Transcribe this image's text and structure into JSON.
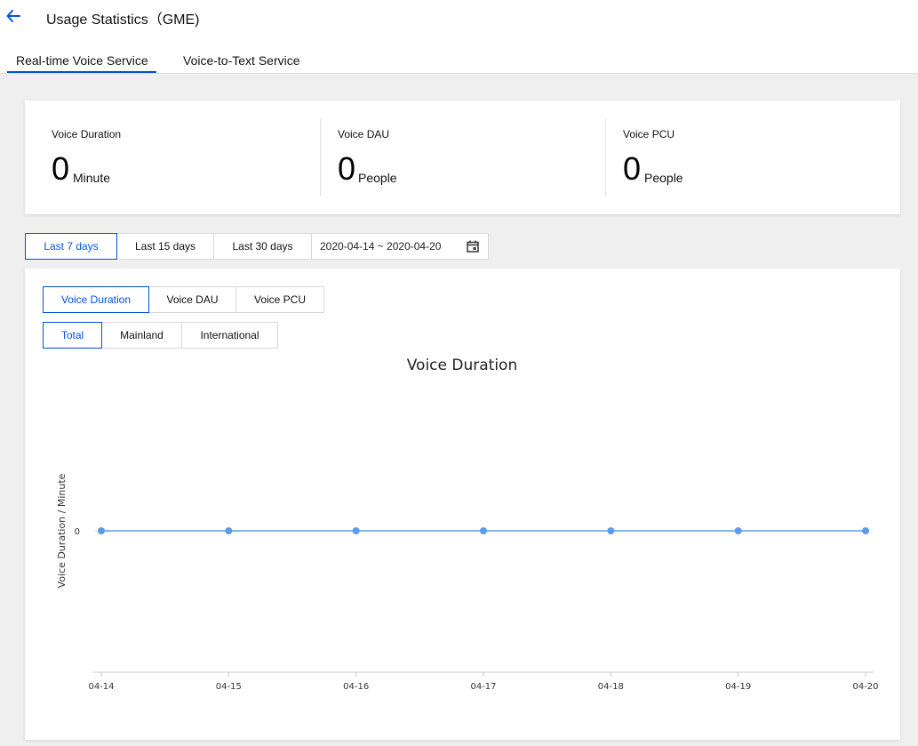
{
  "header": {
    "title": "Usage Statistics（GME)",
    "tabs": [
      {
        "label": "Real-time Voice Service",
        "active": true
      },
      {
        "label": "Voice-to-Text Service",
        "active": false
      }
    ]
  },
  "stats": [
    {
      "label": "Voice Duration",
      "value": "0",
      "unit": "Minute"
    },
    {
      "label": "Voice DAU",
      "value": "0",
      "unit": "People"
    },
    {
      "label": "Voice PCU",
      "value": "0",
      "unit": "People"
    }
  ],
  "range_filter": {
    "options": [
      "Last 7 days",
      "Last 15 days",
      "Last 30 days"
    ],
    "selected": "Last 7 days",
    "date_range": "2020-04-14 ~ 2020-04-20"
  },
  "metric_tabs": {
    "options": [
      "Voice Duration",
      "Voice DAU",
      "Voice PCU"
    ],
    "selected": "Voice Duration"
  },
  "region_tabs": {
    "options": [
      "Total",
      "Mainland",
      "International"
    ],
    "selected": "Total"
  },
  "colors": {
    "accent": "#0052d9",
    "series": "#5b9bea"
  },
  "chart_data": {
    "type": "line",
    "title": "Voice Duration",
    "ylabel": "Voice Duration / Minute",
    "xlabel": "",
    "x": [
      "04-14",
      "04-15",
      "04-16",
      "04-17",
      "04-18",
      "04-19",
      "04-20"
    ],
    "series": [
      {
        "values": [
          0,
          0,
          0,
          0,
          0,
          0,
          0
        ]
      }
    ],
    "yticks": [
      "0"
    ],
    "grid": false
  }
}
